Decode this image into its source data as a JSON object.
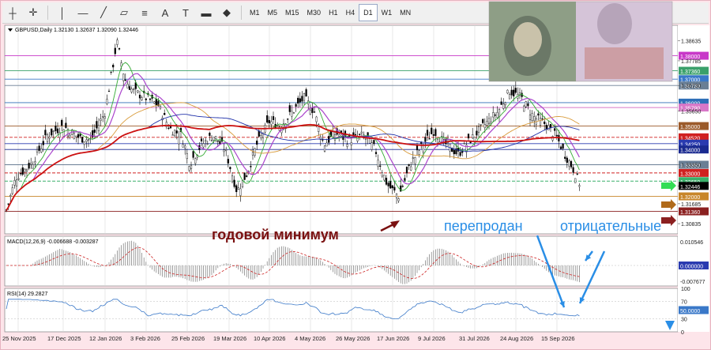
{
  "toolbar": {
    "tools": [
      "crosshair-icon",
      "cursor-icon",
      "vertical-line-icon",
      "horizontal-line-icon",
      "trend-line-icon",
      "equidistant-channel-icon",
      "fibonacci-icon",
      "text-icon",
      "label-icon",
      "rectangle-icon",
      "shapes-icon"
    ],
    "timeframes": [
      "M1",
      "M5",
      "M15",
      "M30",
      "H1",
      "H4",
      "D1",
      "W1",
      "MN"
    ],
    "active_timeframe": "D1"
  },
  "chart_header": "GBPUSD,Daily  1.32130 1.32637 1.32090 1.32446",
  "price_axis": [
    "1.38635",
    "1.37785",
    "1.36730",
    "1.35650",
    "1.33350",
    "1.32446",
    "1.31685",
    "1.30835"
  ],
  "levels": [
    {
      "price": "1.38000",
      "color": "#c838c8"
    },
    {
      "price": "1.37360",
      "color": "#3aa06a"
    },
    {
      "price": "1.37000",
      "color": "#3a78c8"
    },
    {
      "price": "1.36730",
      "color": "#6a7f95"
    },
    {
      "price": "1.36000",
      "color": "#2f6fb8"
    },
    {
      "price": "1.35790",
      "color": "#d877c8"
    },
    {
      "price": "1.35000",
      "color": "#9b5a2a"
    },
    {
      "price": "1.34520",
      "color": "#d02020"
    },
    {
      "price": "1.34250",
      "color": "#2a3bb0"
    },
    {
      "price": "1.34000",
      "color": "#1a2a90"
    },
    {
      "price": "1.33350",
      "color": "#6a7f95"
    },
    {
      "price": "1.33000",
      "color": "#d02020"
    },
    {
      "price": "1.32650",
      "color": "#3ab06a"
    },
    {
      "price": "1.32000",
      "color": "#c8862a"
    },
    {
      "price": "1.31360",
      "color": "#8b2020"
    }
  ],
  "macd": {
    "label": "MACD(12,26,9) -0.006688 -0.003287",
    "axis": [
      "0.010546",
      "0.000000",
      "-0.007677"
    ]
  },
  "rsi": {
    "label": "RSI(14) 29.2827",
    "axis": [
      "100",
      "70",
      "50.0000",
      "30",
      "0"
    ]
  },
  "dates": [
    "25 Nov 2025",
    "17 Dec 2025",
    "12 Jan 2026",
    "3 Feb 2026",
    "25 Feb 2026",
    "19 Mar 2026",
    "10 Apr 2026",
    "4 May 2026",
    "26 May 2026",
    "17 Jun 2026",
    "9 Jul 2026",
    "31 Jul 2026",
    "24 Aug 2026",
    "15 Sep 2026"
  ],
  "annotations": {
    "yearly_low": "годовой минимум",
    "oversold": "перепродан",
    "negative": "отрицательные"
  },
  "colors": {
    "background": "#fde5ea",
    "candles": "#000000",
    "ma_fast": "#33aa33",
    "ma_mid": "#aa44cc",
    "ma_200": "#cc1111",
    "ma_blue": "#2233aa",
    "ma_orange": "#d99b3a",
    "annotation_dark": "#7a1010",
    "annotation_blue": "#2a8ee6"
  }
}
